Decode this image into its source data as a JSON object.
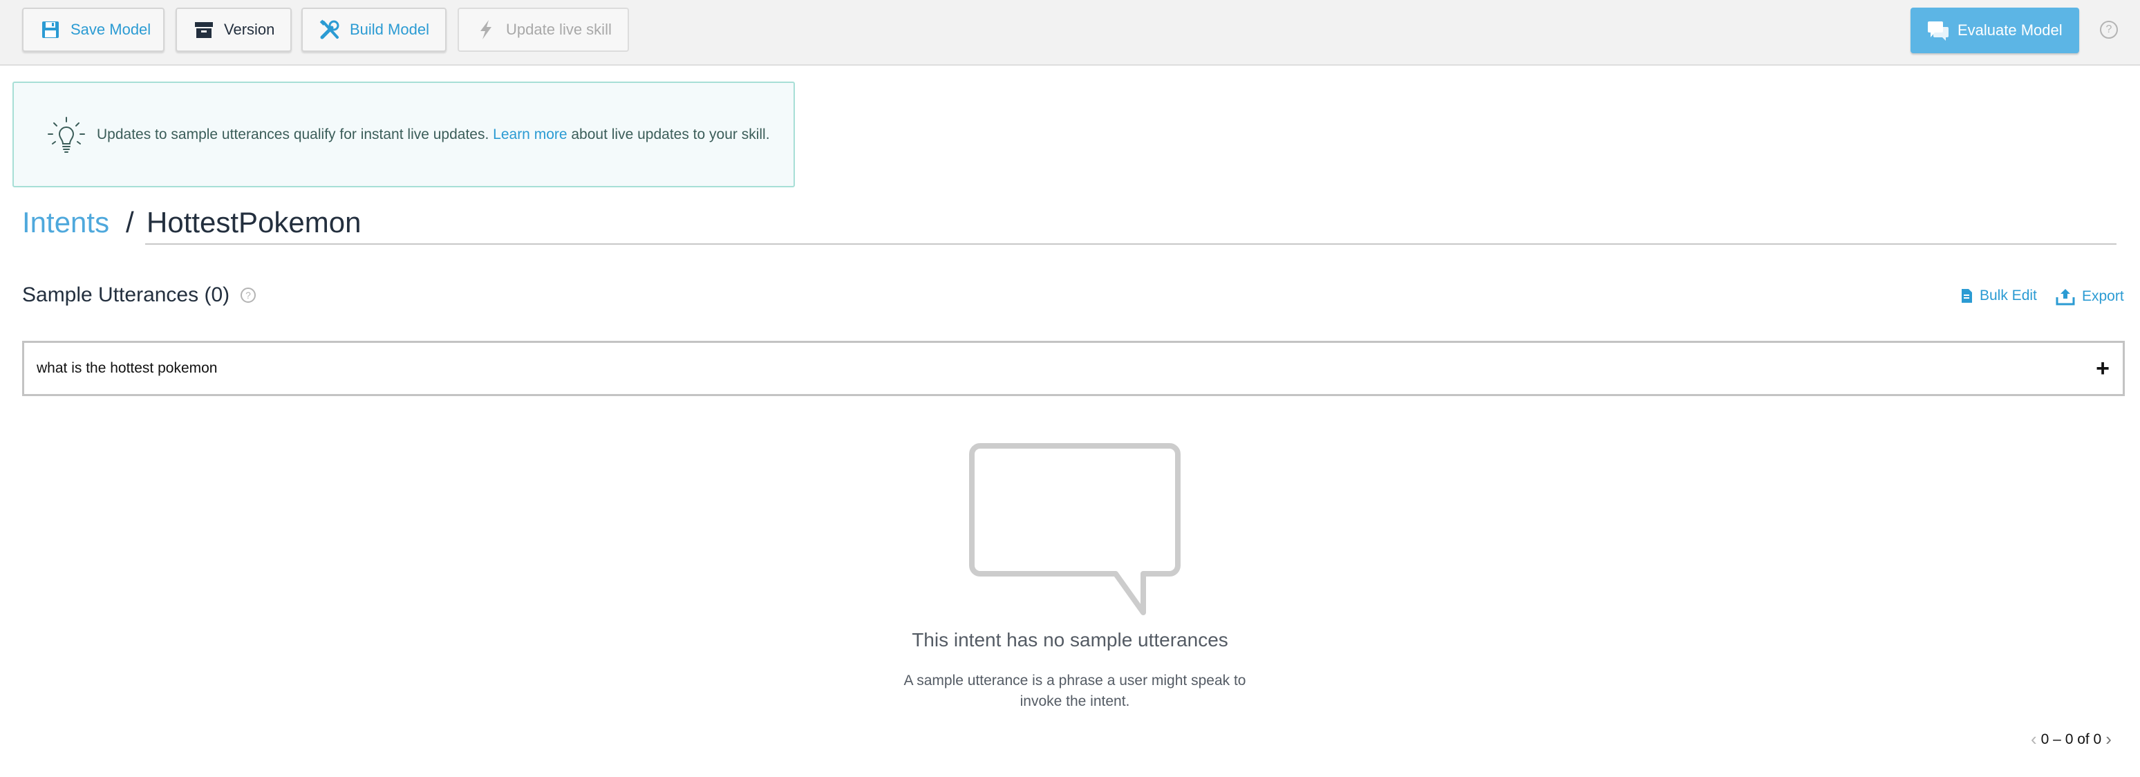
{
  "toolbar": {
    "save_label": "Save Model",
    "version_label": "Version",
    "build_label": "Build Model",
    "live_label": "Update live skill",
    "evaluate_label": "Evaluate Model",
    "help_glyph": "?"
  },
  "banner": {
    "text_before": "Updates to sample utterances qualify for instant live updates. ",
    "link_text": "Learn more",
    "text_after": " about live updates to your skill."
  },
  "breadcrumb": {
    "parent": "Intents",
    "separator": "/",
    "current": "HottestPokemon"
  },
  "section": {
    "title": "Sample Utterances (0)",
    "help_glyph": "?",
    "bulk_edit_label": "Bulk Edit",
    "export_label": "Export"
  },
  "utterance_input": {
    "value": "what is the hottest pokemon",
    "add_glyph": "+"
  },
  "empty_state": {
    "title": "This intent has no sample utterances",
    "description": "A sample utterance is a phrase a user might speak to invoke the intent."
  },
  "pagination": {
    "prev_glyph": "‹",
    "text": "0 – 0 of 0",
    "next_glyph": "›"
  },
  "icons": {
    "save": "save-icon",
    "version": "archive-icon",
    "build": "tools-icon",
    "live": "lightning-icon",
    "evaluate": "chat-icon",
    "bulb": "lightbulb-icon",
    "bulk_edit": "document-icon",
    "export": "upload-icon",
    "bubble": "speech-bubble-icon"
  },
  "colors": {
    "accent": "#2b9bd3",
    "evaluate_bg": "#5cb5e5",
    "banner_bg": "#f4fafb",
    "banner_border": "#a7dfd6"
  }
}
